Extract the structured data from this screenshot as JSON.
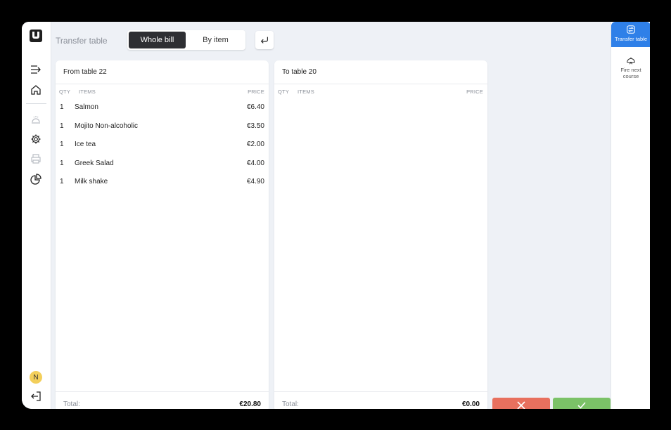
{
  "header": {
    "title": "Transfer table",
    "segment": {
      "whole_bill": "Whole bill",
      "by_item": "By item",
      "selected": "Whole bill"
    }
  },
  "sidebar": {
    "avatar_initial": "N",
    "icons": [
      "logo-icon",
      "collapse-menu-icon",
      "home-icon",
      "service-bell-icon",
      "gear-icon",
      "printer-icon",
      "reports-pie-icon",
      "logout-icon"
    ]
  },
  "from_panel": {
    "title": "From table 22",
    "columns": {
      "qty": "QTY",
      "items": "ITEMS",
      "price": "PRICE"
    },
    "rows": [
      {
        "qty": "1",
        "name": "Salmon",
        "price": "€6.40"
      },
      {
        "qty": "1",
        "name": "Mojito Non-alcoholic",
        "price": "€3.50"
      },
      {
        "qty": "1",
        "name": "Ice tea",
        "price": "€2.00"
      },
      {
        "qty": "1",
        "name": "Greek Salad",
        "price": "€4.00"
      },
      {
        "qty": "1",
        "name": "Milk shake",
        "price": "€4.90"
      }
    ],
    "total_label": "Total:",
    "total_value": "€20.80"
  },
  "to_panel": {
    "title": "To table 20",
    "columns": {
      "qty": "QTY",
      "items": "ITEMS",
      "price": "PRICE"
    },
    "rows": [],
    "total_label": "Total:",
    "total_value": "€0.00"
  },
  "right_sidebar": {
    "transfer_label": "Transfer table",
    "fire_label_1": "Fire next",
    "fire_label_2": "course"
  },
  "colors": {
    "accent": "#2f80e8",
    "cancel": "#e8705e",
    "confirm": "#7bc267",
    "segment_active": "#2e2f33"
  }
}
